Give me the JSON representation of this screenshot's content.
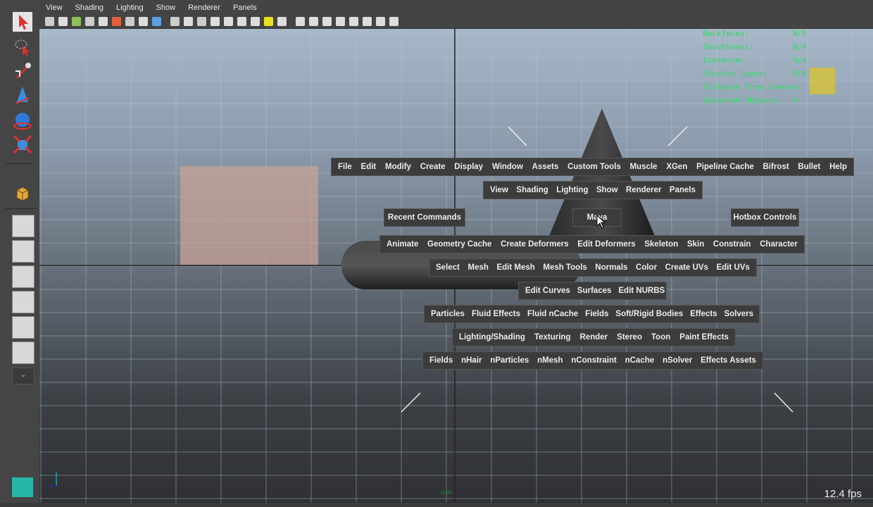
{
  "panel_menu": [
    "View",
    "Shading",
    "Lighting",
    "Show",
    "Renderer",
    "Panels"
  ],
  "hud": [
    {
      "label": "Backfaces:",
      "value": "N/A"
    },
    {
      "label": "Smoothness:",
      "value": "N/A"
    },
    {
      "label": "Instance:",
      "value": "N/A"
    },
    {
      "label": "Display Layer:",
      "value": "N/A"
    },
    {
      "label": "Distance From Camera:",
      "value": ""
    },
    {
      "label": "Selected Objects:",
      "value": "0"
    }
  ],
  "fps": "12.4 fps",
  "camera_label": "side",
  "hotbox": {
    "main_menu": [
      "File",
      "Edit",
      "Modify",
      "Create",
      "Display",
      "Window",
      "Assets",
      "Custom Tools",
      "Muscle",
      "XGen",
      "Pipeline Cache",
      "Bifrost",
      "Bullet",
      "Help"
    ],
    "panel_menu": [
      "View",
      "Shading",
      "Lighting",
      "Show",
      "Renderer",
      "Panels"
    ],
    "recent_commands": "Recent Commands",
    "center": "Maya",
    "hotbox_controls": "Hotbox Controls",
    "animation_menu": [
      "Animate",
      "Geometry Cache",
      "Create Deformers",
      "Edit Deformers",
      "Skeleton",
      "Skin",
      "Constrain",
      "Character"
    ],
    "polygon_menu": [
      "Select",
      "Mesh",
      "Edit Mesh",
      "Mesh Tools",
      "Normals",
      "Color",
      "Create UVs",
      "Edit UVs"
    ],
    "surfaces_menu": [
      "Edit Curves",
      "Surfaces",
      "Edit NURBS"
    ],
    "dynamics_menu": [
      "Particles",
      "Fluid Effects",
      "Fluid nCache",
      "Fields",
      "Soft/Rigid Bodies",
      "Effects",
      "Solvers"
    ],
    "rendering_menu": [
      "Lighting/Shading",
      "Texturing",
      "Render",
      "Stereo",
      "Toon",
      "Paint Effects"
    ],
    "nDynamics_menu": [
      "Fields",
      "nHair",
      "nParticles",
      "nMesh",
      "nConstraint",
      "nCache",
      "nSolver",
      "Effects Assets"
    ]
  },
  "colors": {
    "hud_text": "#4fd17e",
    "hotbox_bg": "#3c3c3c",
    "select_arrow": "#e23030"
  },
  "icons": [
    "select-arrow-icon",
    "lasso-icon",
    "paint-select-icon",
    "move-icon",
    "rotate-icon",
    "scale-icon",
    "cube-icon"
  ]
}
